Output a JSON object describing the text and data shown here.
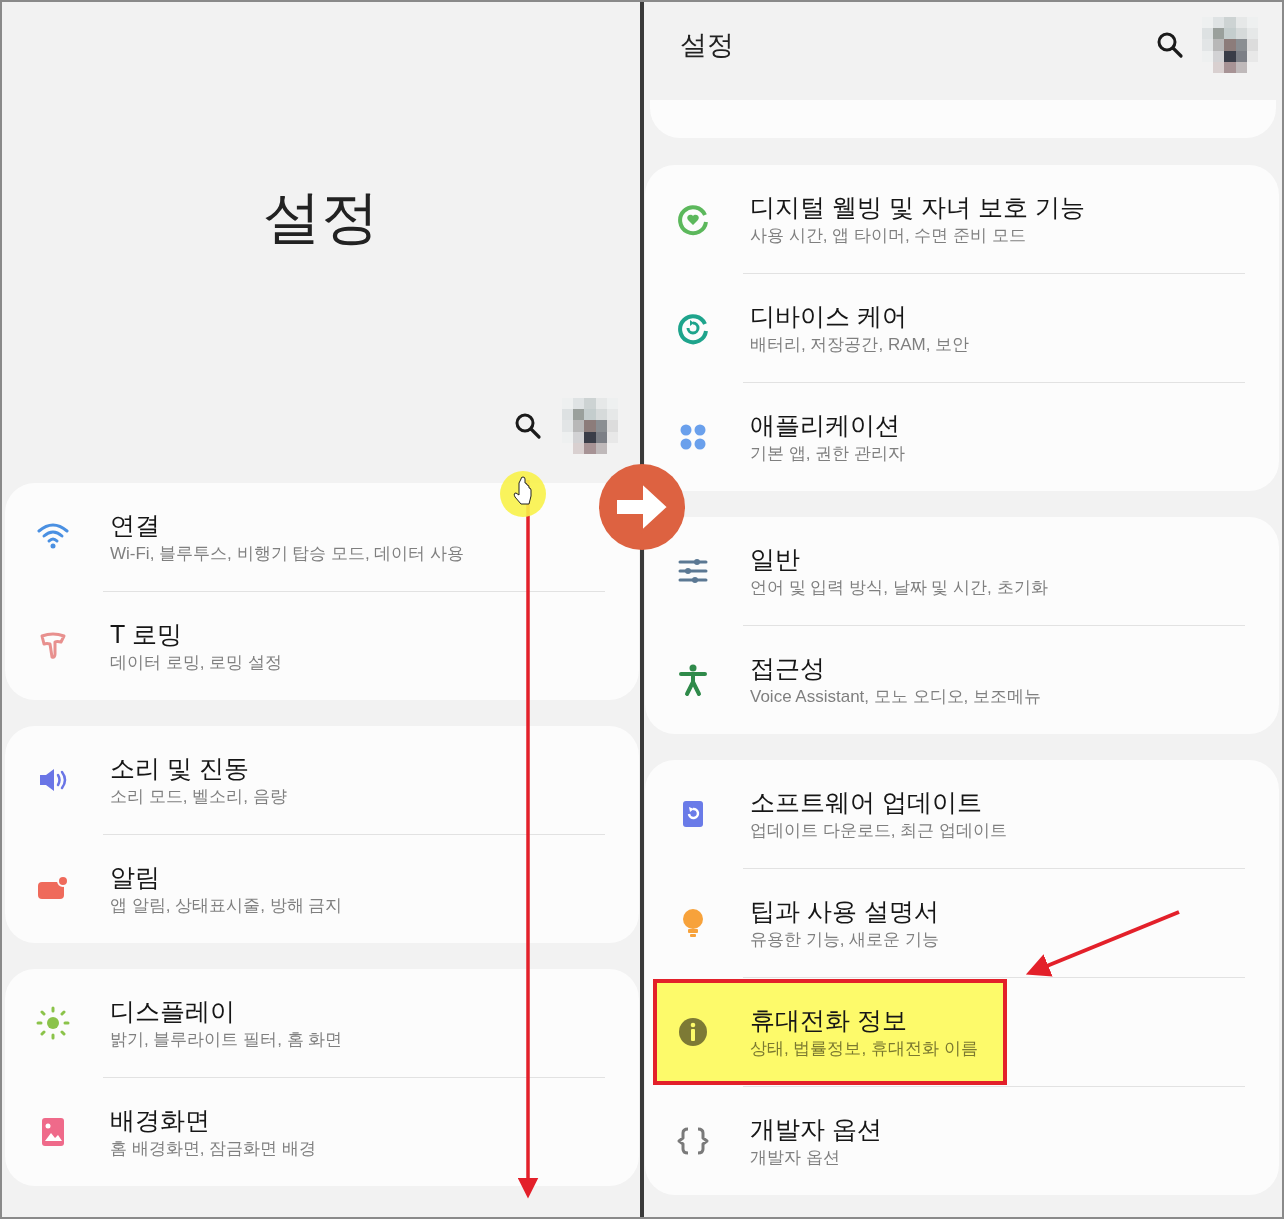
{
  "left_screen": {
    "title": "설정",
    "groups": [
      [
        {
          "kind": "wifi",
          "title": "연결",
          "subtitle": "Wi-Fi, 블루투스, 비행기 탑승 모드, 데이터 사용",
          "highlighted": false
        },
        {
          "kind": "roaming",
          "title": "T 로밍",
          "subtitle": "데이터 로밍, 로밍 설정",
          "highlighted": false
        }
      ],
      [
        {
          "kind": "sound",
          "title": "소리 및 진동",
          "subtitle": "소리 모드, 벨소리, 음량",
          "highlighted": false
        },
        {
          "kind": "notification",
          "title": "알림",
          "subtitle": "앱 알림, 상태표시줄, 방해 금지",
          "highlighted": false
        }
      ],
      [
        {
          "kind": "display",
          "title": "디스플레이",
          "subtitle": "밝기, 블루라이트 필터, 홈 화면",
          "highlighted": false
        },
        {
          "kind": "wallpaper",
          "title": "배경화면",
          "subtitle": "홈 배경화면, 잠금화면 배경",
          "highlighted": false
        }
      ]
    ]
  },
  "right_screen": {
    "title": "설정",
    "groups": [
      [
        {
          "kind": "wellbeing",
          "title": "디지털 웰빙 및 자녀 보호 기능",
          "subtitle": "사용 시간, 앱 타이머, 수면 준비 모드",
          "highlighted": false
        },
        {
          "kind": "device_care",
          "title": "디바이스 케어",
          "subtitle": "배터리, 저장공간, RAM, 보안",
          "highlighted": false
        },
        {
          "kind": "apps",
          "title": "애플리케이션",
          "subtitle": "기본 앱, 권한 관리자",
          "highlighted": false
        }
      ],
      [
        {
          "kind": "general",
          "title": "일반",
          "subtitle": "언어 및 입력 방식, 날짜 및 시간, 초기화",
          "highlighted": false
        },
        {
          "kind": "accessibility",
          "title": "접근성",
          "subtitle": "Voice Assistant, 모노 오디오, 보조메뉴",
          "highlighted": false
        }
      ],
      [
        {
          "kind": "update",
          "title": "소프트웨어 업데이트",
          "subtitle": "업데이트 다운로드, 최근 업데이트",
          "highlighted": false
        },
        {
          "kind": "tips",
          "title": "팁과 사용 설명서",
          "subtitle": "유용한 기능, 새로운 기능",
          "highlighted": false
        },
        {
          "kind": "info",
          "title": "휴대전화 정보",
          "subtitle": "상태, 법률정보, 휴대전화 이름",
          "highlighted": true
        },
        {
          "kind": "developer",
          "title": "개발자 옵션",
          "subtitle": "개발자 옵션",
          "highlighted": false
        }
      ]
    ]
  }
}
